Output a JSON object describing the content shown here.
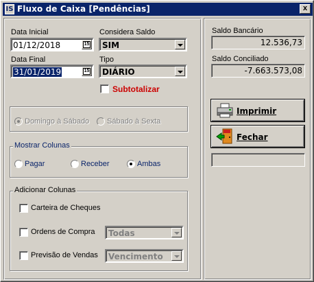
{
  "window": {
    "title": "Fluxo de Caixa [Pendências]",
    "app_icon_text": "IS",
    "close_label": "x"
  },
  "filters": {
    "data_inicial_label": "Data Inicial",
    "data_inicial_value": "01/12/2018",
    "data_final_label": "Data Final",
    "data_final_value": "31/01/2019",
    "calendar_btn": "15",
    "considera_saldo_label": "Considera Saldo",
    "considera_saldo_value": "SIM",
    "tipo_label": "Tipo",
    "tipo_value": "DIÁRIO",
    "subtotalizar_label": "Subtotalizar"
  },
  "weekdays": {
    "domingo_sabado": "Domingo à Sábado",
    "sabado_sexta": "Sábado à Sexta"
  },
  "mostrar_colunas": {
    "legend": "Mostrar Colunas",
    "pagar": "Pagar",
    "receber": "Receber",
    "ambas": "Ambas",
    "selected": "Ambas"
  },
  "adicionar_colunas": {
    "legend": "Adicionar Colunas",
    "carteira": "Carteira de Cheques",
    "ordens": "Ordens de Compra",
    "ordens_combo": "Todas",
    "previsao": "Previsão de Vendas",
    "previsao_combo": "Vencimento"
  },
  "saldos": {
    "bancario_label": "Saldo Bancário",
    "bancario_value": "12.536,73",
    "conciliado_label": "Saldo Conciliado",
    "conciliado_value": "-7.663.573,08"
  },
  "actions": {
    "imprimir_label": "Imprimir",
    "fechar_label": "Fechar"
  },
  "colors": {
    "title_bar": "#0a246a",
    "subtotalizar": "#cc0000",
    "face": "#d4d0c8"
  }
}
